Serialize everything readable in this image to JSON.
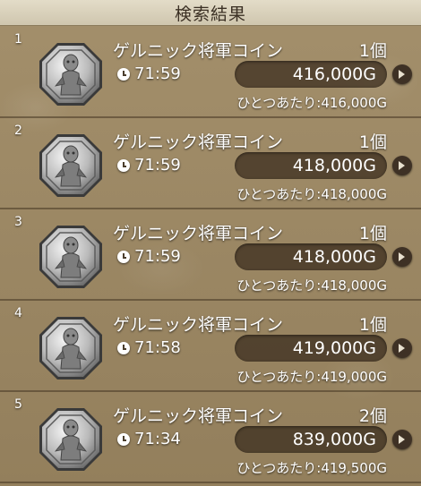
{
  "header": {
    "title": "検索結果"
  },
  "results": [
    {
      "index": "1",
      "name": "ゲルニック将軍コイン",
      "quantity": "1個",
      "time": "71:59",
      "price": "416,000G",
      "unit_price": "ひとつあたり:416,000G"
    },
    {
      "index": "2",
      "name": "ゲルニック将軍コイン",
      "quantity": "1個",
      "time": "71:59",
      "price": "418,000G",
      "unit_price": "ひとつあたり:418,000G"
    },
    {
      "index": "3",
      "name": "ゲルニック将軍コイン",
      "quantity": "1個",
      "time": "71:59",
      "price": "418,000G",
      "unit_price": "ひとつあたり:418,000G"
    },
    {
      "index": "4",
      "name": "ゲルニック将軍コイン",
      "quantity": "1個",
      "time": "71:58",
      "price": "419,000G",
      "unit_price": "ひとつあたり:419,000G"
    },
    {
      "index": "5",
      "name": "ゲルニック将軍コイン",
      "quantity": "2個",
      "time": "71:34",
      "price": "839,000G",
      "unit_price": "ひとつあたり:419,500G"
    }
  ],
  "icons": {
    "item": "coin-icon",
    "timer": "clock-icon",
    "next": "chevron-right-icon"
  }
}
